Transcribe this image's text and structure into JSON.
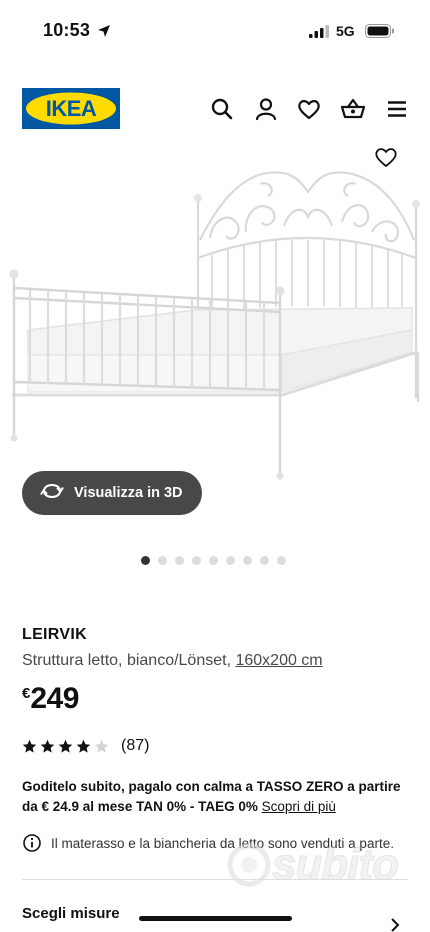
{
  "status_bar": {
    "time": "10:53",
    "network": "5G"
  },
  "header": {
    "logo_text": "IKEA",
    "icons": [
      "search-icon",
      "user-icon",
      "heart-icon",
      "basket-icon",
      "menu-icon"
    ]
  },
  "gallery": {
    "view_3d_label": "Visualizza in 3D",
    "slide_count": 9,
    "active_slide": 1
  },
  "product": {
    "name": "LEIRVIK",
    "description": "Struttura letto, bianco/Lönset, ",
    "size": "160x200 cm",
    "currency": "€",
    "price": "249",
    "rating": 4,
    "rating_max": 5,
    "reviews": "(87)"
  },
  "finance": {
    "text": "Goditelo subito, pagalo con calma a TASSO ZERO a partire da € 24.9 al mese TAN 0% - TAEG 0% ",
    "link": "Scopri di più"
  },
  "notice": {
    "text": "Il materasso e la biancheria da letto sono venduti a parte."
  },
  "section": {
    "title": "Scegli misure"
  },
  "watermark": {
    "text": "subito"
  },
  "colors": {
    "ikea_blue": "#0058A3",
    "ikea_yellow": "#FFDB00",
    "dark_button": "#484848"
  }
}
